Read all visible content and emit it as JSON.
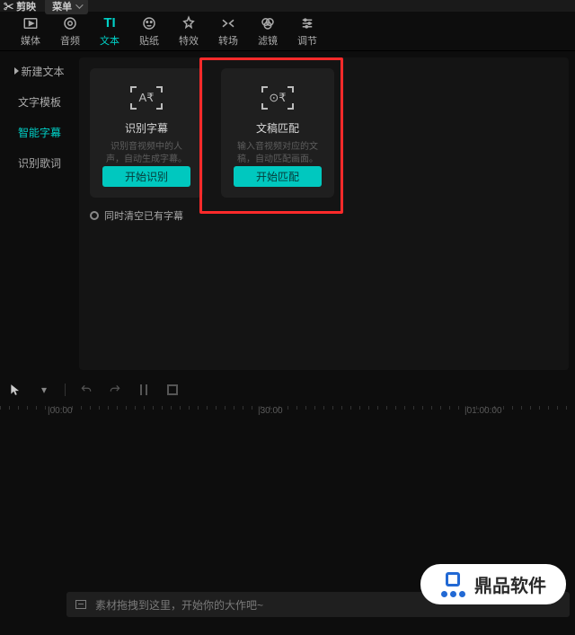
{
  "titlebar": {
    "app": "剪映",
    "menu": "菜单"
  },
  "toolbar": [
    {
      "label": "媒体",
      "active": false
    },
    {
      "label": "音频",
      "active": false
    },
    {
      "label": "文本",
      "active": true
    },
    {
      "label": "贴纸",
      "active": false
    },
    {
      "label": "特效",
      "active": false
    },
    {
      "label": "转场",
      "active": false
    },
    {
      "label": "滤镜",
      "active": false
    },
    {
      "label": "调节",
      "active": false
    }
  ],
  "sidebar": [
    {
      "label": "新建文本",
      "hasArrow": true,
      "active": false
    },
    {
      "label": "文字模板",
      "hasArrow": false,
      "active": false
    },
    {
      "label": "智能字幕",
      "hasArrow": false,
      "active": true
    },
    {
      "label": "识别歌词",
      "hasArrow": false,
      "active": false
    }
  ],
  "cards": {
    "subtitle": {
      "title": "识别字幕",
      "desc": "识别音视频中的人声，自动生成字幕。",
      "button": "开始识别",
      "iconInner": "A₹"
    },
    "match": {
      "title": "文稿匹配",
      "desc": "输入音视频对应的文稿，自动匹配画面。",
      "button": "开始匹配",
      "iconInner": "⊙₹"
    }
  },
  "clear": {
    "label": "同时清空已有字幕"
  },
  "ruler": [
    {
      "label": "|00:00",
      "pos": 53
    },
    {
      "label": "|30:00",
      "pos": 287
    },
    {
      "label": "|01:00:00",
      "pos": 517
    }
  ],
  "track": {
    "placeholder": "素材拖拽到这里，开始你的大作吧~"
  },
  "watermark": {
    "text": "鼎品软件"
  }
}
